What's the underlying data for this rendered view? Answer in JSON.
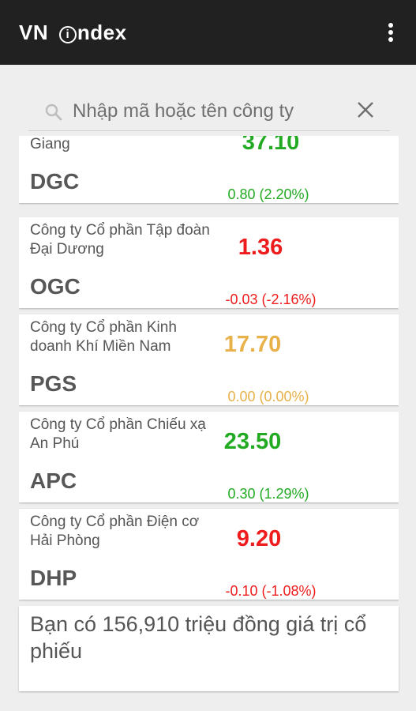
{
  "app": {
    "title_prefix": "VN ",
    "title_icon": "i",
    "title_suffix": "ndex"
  },
  "search": {
    "placeholder": "Nhập mã hoặc tên công ty",
    "value": ""
  },
  "colors": {
    "up": "#22aa22",
    "down": "#ee1c1c",
    "unchanged": "#e8b14a",
    "appbar": "#212121"
  },
  "stocks": [
    {
      "name": "giặt và Hóa chất Đức Giang",
      "symbol": "DGC",
      "price": "37.10",
      "change": "0.80 (2.20%)",
      "trend": "up"
    },
    {
      "name": "Công ty Cổ phần Tập đoàn Đại Dương",
      "symbol": "OGC",
      "price": "1.36",
      "change": "-0.03 (-2.16%)",
      "trend": "down"
    },
    {
      "name": "Công ty Cổ phần Kinh doanh Khí Miền Nam",
      "symbol": "PGS",
      "price": "17.70",
      "change": "0.00 (0.00%)",
      "trend": "unchanged"
    },
    {
      "name": "Công ty Cổ phần Chiếu xạ An Phú",
      "symbol": "APC",
      "price": "23.50",
      "change": "0.30 (1.29%)",
      "trend": "up"
    },
    {
      "name": "Công ty Cổ phần Điện cơ Hải Phòng",
      "symbol": "DHP",
      "price": "9.20",
      "change": "-0.10 (-1.08%)",
      "trend": "down"
    }
  ],
  "portfolio_total": "Bạn có 156,910 triệu đồng giá trị cổ phiếu"
}
